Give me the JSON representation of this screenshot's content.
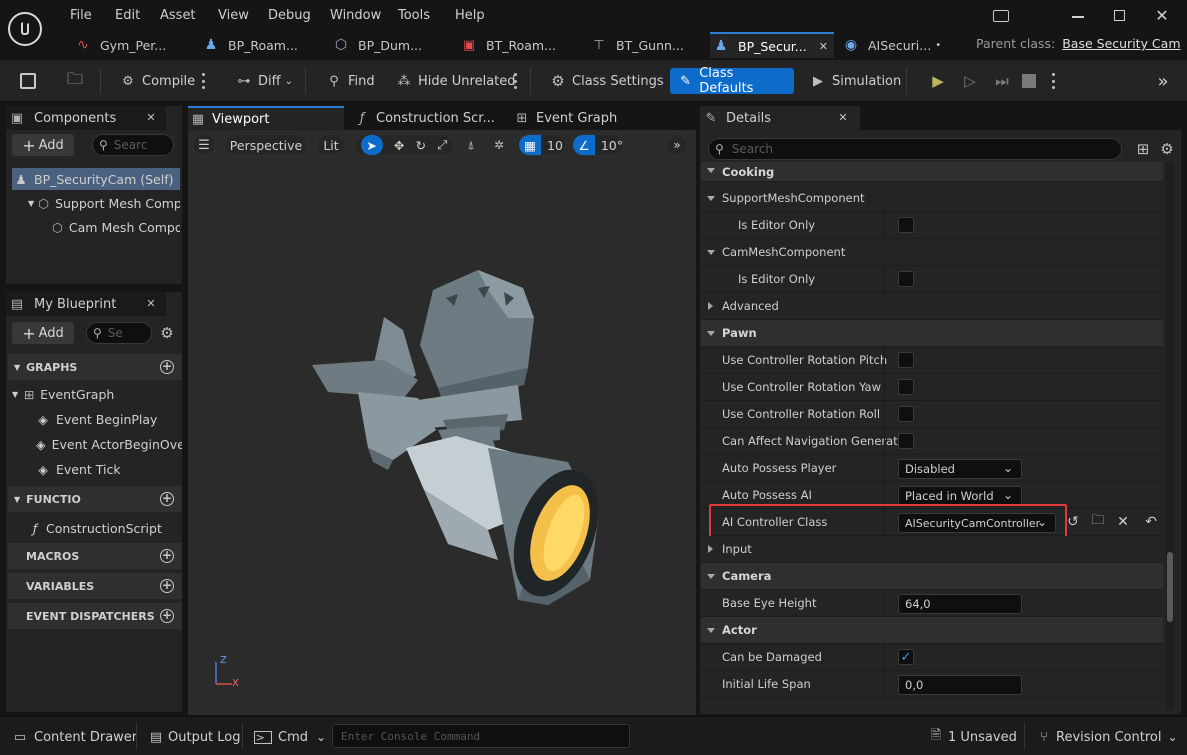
{
  "menu": [
    "File",
    "Edit",
    "Asset",
    "View",
    "Debug",
    "Window",
    "Tools",
    "Help"
  ],
  "tabs": [
    {
      "label": "Gym_Per...",
      "icon": "level-icon"
    },
    {
      "label": "BP_Roam...",
      "icon": "pawn-icon"
    },
    {
      "label": "BP_Dum...",
      "icon": "mesh-icon"
    },
    {
      "label": "BT_Roam...",
      "icon": "behavior-tree-icon"
    },
    {
      "label": "BT_Gunn...",
      "icon": "behavior-tree-icon"
    },
    {
      "label": "BP_Secur...",
      "icon": "pawn-icon"
    },
    {
      "label": "AISecuri...",
      "icon": "ai-controller-icon"
    }
  ],
  "parent_class": {
    "label": "Parent class:",
    "value": "Base Security Cam"
  },
  "toolbar": {
    "compile": "Compile",
    "diff": "Diff",
    "find": "Find",
    "hide_unrelated": "Hide Unrelated",
    "class_settings": "Class Settings",
    "class_defaults": "Class Defaults",
    "simulation": "Simulation"
  },
  "components": {
    "title": "Components",
    "add": "Add",
    "search_placeholder": "Searc",
    "items": [
      "BP_SecurityCam (Self)",
      "Support Mesh Comp",
      "Cam Mesh Compo"
    ]
  },
  "my_blueprint": {
    "title": "My Blueprint",
    "add": "Add",
    "search_placeholder": "Se",
    "graphs_header": "GRAPHS",
    "event_graph": "EventGraph",
    "events": [
      "Event BeginPlay",
      "Event ActorBeginOver",
      "Event Tick"
    ],
    "functions_header": "FUNCTIO",
    "construction_script": "ConstructionScript",
    "macros_header": "MACROS",
    "variables_header": "VARIABLES",
    "dispatchers_header": "EVENT DISPATCHERS"
  },
  "editor_tabs": {
    "viewport": "Viewport",
    "construction": "Construction Scr...",
    "event_graph": "Event Graph"
  },
  "viewport": {
    "perspective": "Perspective",
    "lit": "Lit",
    "grid_snap": "10",
    "rot_snap": "10°",
    "axis_z": "Z",
    "axis_x": "X"
  },
  "details": {
    "title": "Details",
    "search_placeholder": "Search",
    "rows": [
      {
        "type": "category",
        "label": "Cooking"
      },
      {
        "type": "subcategory",
        "label": "SupportMeshComponent"
      },
      {
        "type": "checkbox",
        "label": "Is Editor Only",
        "checked": false,
        "indent": true
      },
      {
        "type": "subcategory",
        "label": "CamMeshComponent"
      },
      {
        "type": "checkbox",
        "label": "Is Editor Only",
        "checked": false,
        "indent": true
      },
      {
        "type": "collapsed",
        "label": "Advanced"
      },
      {
        "type": "category",
        "label": "Pawn"
      },
      {
        "type": "checkbox",
        "label": "Use Controller Rotation Pitch",
        "checked": false
      },
      {
        "type": "checkbox",
        "label": "Use Controller Rotation Yaw",
        "checked": false
      },
      {
        "type": "checkbox",
        "label": "Use Controller Rotation Roll",
        "checked": false
      },
      {
        "type": "checkbox",
        "label": "Can Affect Navigation Generat...",
        "checked": false
      },
      {
        "type": "combo",
        "label": "Auto Possess Player",
        "value": "Disabled"
      },
      {
        "type": "combo",
        "label": "Auto Possess AI",
        "value": "Placed in World"
      },
      {
        "type": "classpicker",
        "label": "AI Controller Class",
        "value": "AISecurityCamController"
      },
      {
        "type": "collapsed",
        "label": "Input"
      },
      {
        "type": "category",
        "label": "Camera"
      },
      {
        "type": "number",
        "label": "Base Eye Height",
        "value": "64,0"
      },
      {
        "type": "category",
        "label": "Actor"
      },
      {
        "type": "checkbox",
        "label": "Can be Damaged",
        "checked": true
      },
      {
        "type": "number",
        "label": "Initial Life Span",
        "value": "0,0"
      }
    ]
  },
  "statusbar": {
    "content_drawer": "Content Drawer",
    "output_log": "Output Log",
    "cmd": "Cmd",
    "console_placeholder": "Enter Console Command",
    "unsaved": "1 Unsaved",
    "revision_control": "Revision Control"
  },
  "colors": {
    "accent": "#0d6bc9",
    "highlight": "#e23a3a",
    "lens": "#f4c04a"
  }
}
